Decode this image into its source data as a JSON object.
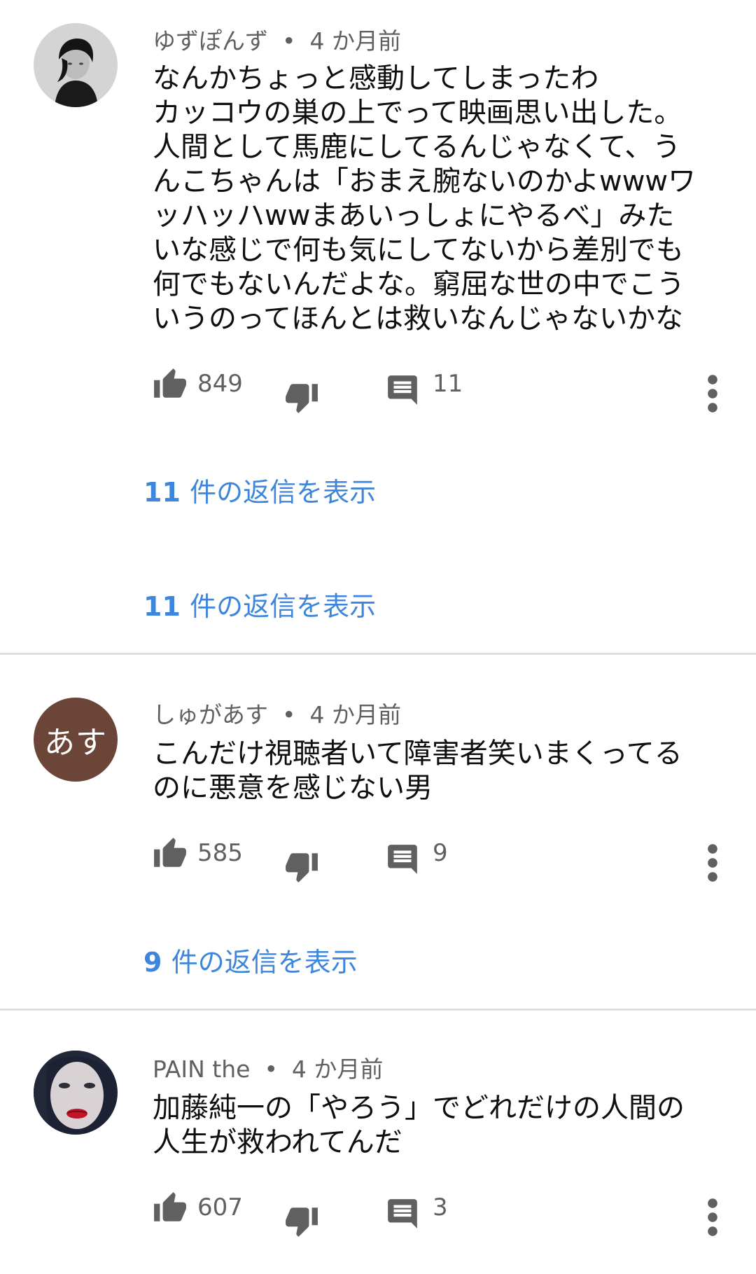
{
  "comments": [
    {
      "author": "ゆずぽんず",
      "time": "4 か月前",
      "text": "なんかちょっと感動してしまったわ\nカッコウの巣の上でって映画思い出した。\n人間として馬鹿にしてるんじゃなくて、う\nんこちゃんは「おまえ腕ないのかよwwwワ\nッハッハwwまあいっしょにやるべ」みた\nいな感じで何も気にしてないから差別でも\n何でもないんだよな。窮屈な世の中でこう\nいうのってほんとは救いなんじゃないかな",
      "likes": "849",
      "reply_count": "11",
      "replies_link_number": "11",
      "replies_link_text": "件の返信を表示"
    },
    {
      "author": "しゅがあす",
      "avatar_text": "あす",
      "time": "4 か月前",
      "text": "こんだけ視聴者いて障害者笑いまくってる\nのに悪意を感じない男",
      "likes": "585",
      "reply_count": "9",
      "replies_link_number": "9",
      "replies_link_text": "件の返信を表示"
    },
    {
      "author": "PAIN the",
      "time": "4 か月前",
      "text": "加藤純一の「やろう」でどれだけの人間の\n人生が救われてんだ",
      "likes": "607",
      "reply_count": "3"
    }
  ],
  "icons": {
    "like": "thumb-up-icon",
    "dislike": "thumb-down-icon",
    "reply": "comment-icon",
    "more": "more-vertical-icon"
  },
  "colors": {
    "link": "#3e86db",
    "meta": "#606060",
    "avatar_bg": "#6b4537",
    "divider": "#dedede"
  }
}
